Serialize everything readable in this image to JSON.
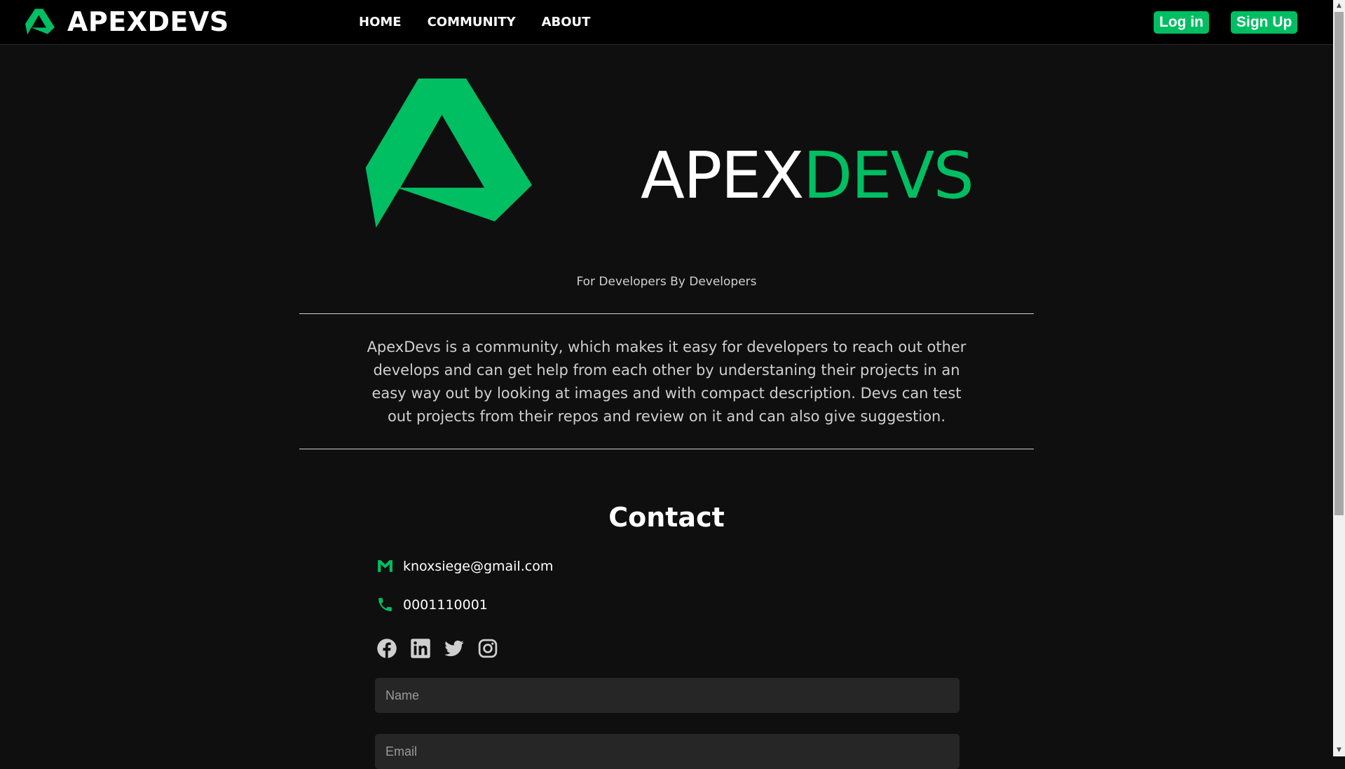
{
  "brand": {
    "name": "APEXDEVS",
    "accent": "#00be62"
  },
  "nav": {
    "items": [
      "HOME",
      "COMMUNITY",
      "ABOUT"
    ]
  },
  "auth": {
    "login": "Log in",
    "signup": "Sign Up"
  },
  "hero": {
    "title_white": "APEX",
    "title_green": "DEVS",
    "tagline": "For Developers By Developers",
    "about": "ApexDevs is a community, which makes it easy for developers to reach out other develops and can get help from each other by understaning their projects in an easy way out by looking at images and with compact description. Devs can test out projects from their repos and review on it and can also give suggestion."
  },
  "contact": {
    "title": "Contact",
    "email": "knoxsiege@gmail.com",
    "phone": "0001110001",
    "socials": [
      "facebook-icon",
      "linkedin-icon",
      "twitter-icon",
      "instagram-icon"
    ],
    "form": {
      "name_placeholder": "Name",
      "email_placeholder": "Email"
    }
  }
}
